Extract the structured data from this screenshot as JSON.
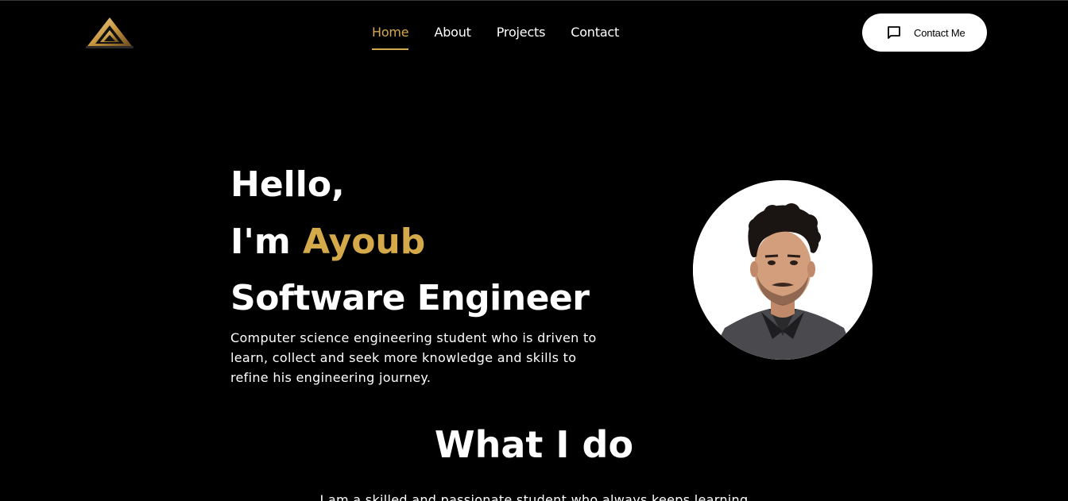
{
  "nav": {
    "logo": "brand-logo",
    "links": [
      {
        "label": "Home",
        "active": true
      },
      {
        "label": "About",
        "active": false
      },
      {
        "label": "Projects",
        "active": false
      },
      {
        "label": "Contact",
        "active": false
      }
    ],
    "contact_button": {
      "label": "Contact Me",
      "icon": "message-square-icon"
    }
  },
  "hero": {
    "greeting": "Hello,",
    "intro_prefix": "I'm",
    "name": "Ayoub",
    "role": "Software Engineer",
    "description": "Computer science engineering student who is driven to learn, collect and seek more knowledge and skills to refine his engineering journey.",
    "avatar": "profile-photo"
  },
  "what_i_do": {
    "title": "What I do",
    "text": "I am a skilled and passionate student who always keeps learning"
  },
  "colors": {
    "background": "#000000",
    "accent": "#d4a94a",
    "text": "#ffffff",
    "button_bg": "#ffffff"
  }
}
